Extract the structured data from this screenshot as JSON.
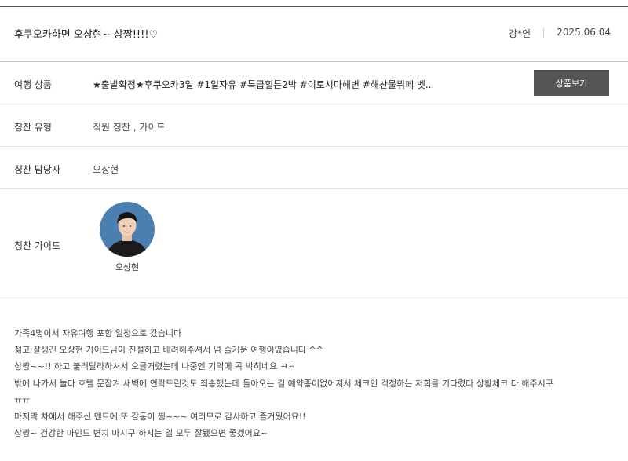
{
  "post": {
    "title": "후쿠오카하면 오상현~ 상짱!!!!♡",
    "author": "강*연",
    "date": "2025.06.04"
  },
  "rows": {
    "product": {
      "label": "여행 상품",
      "value": "★출발확정★후쿠오카3일 #1일자유 #특급힐튼2박 #이토시마해변 #해산물뷔페 벳...",
      "button_label": "상품보기"
    },
    "praise_type": {
      "label": "칭찬 유형",
      "value": "직원 칭찬 , 가이드"
    },
    "praise_staff": {
      "label": "칭찬 담당자",
      "value": "오상현"
    },
    "praise_guide": {
      "label": "칭찬 가이드",
      "guide_name": "오상현"
    }
  },
  "review": {
    "lines": [
      "가족4명이서 자유여행 포함 일정으로 갔습니다",
      "젊고 잘생긴 오상현 가이드님이 친절하고 배려해주셔서 넘 즐거운 여행이였습니다 ^^",
      "상짱~~!! 하고 불러달라하셔서 오글거렸는데 나중엔 기억에 콕 박히네요 ㅋㅋ",
      "밖에 나가서 놀다 호텔 문잠겨 새벽에 연락드린것도 죄송했는데 돌아오는 길 예약종이없어져서 체크인 걱정하는 저희를 기다렸다 상황체크 다 해주시구",
      "ㅠㅠ",
      "마지막 차에서 해주신 멘트에 또 감동이 찡~~~ 여러모로 감사하고 즐거웠어요!!",
      "상짱~ 건강한 마인드 변치 마시구 하시는 일 모두 잘됐으면 좋겠어요~"
    ]
  },
  "colors": {
    "button_bg": "#555555",
    "button_text": "#ffffff",
    "divider": "#e2e2e2"
  }
}
